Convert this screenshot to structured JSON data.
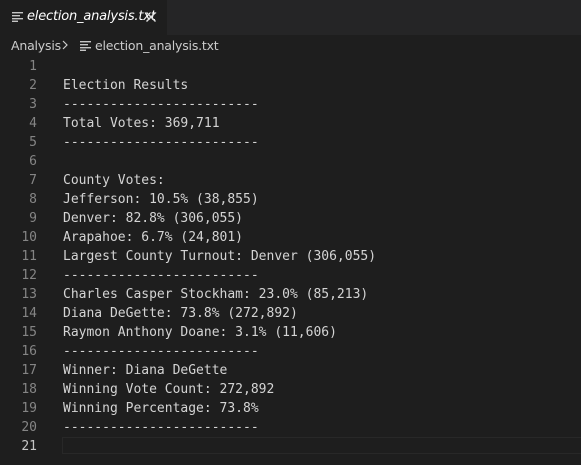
{
  "tab": {
    "label": "election_analysis.txt",
    "icon": "text-file-icon"
  },
  "breadcrumb": {
    "root": "Analysis",
    "file": "election_analysis.txt"
  },
  "colors": {
    "editor_bg": "#1e1e1e",
    "tabbar_bg": "#252526",
    "text": "#d4d4d4",
    "line_number": "#858585",
    "active_line_number": "#c6c6c6"
  },
  "editor": {
    "active_line": 21,
    "lines": [
      {
        "num": "1",
        "text": ""
      },
      {
        "num": "2",
        "text": "Election Results"
      },
      {
        "num": "3",
        "text": "-------------------------"
      },
      {
        "num": "4",
        "text": "Total Votes: 369,711"
      },
      {
        "num": "5",
        "text": "-------------------------"
      },
      {
        "num": "6",
        "text": ""
      },
      {
        "num": "7",
        "text": "County Votes:"
      },
      {
        "num": "8",
        "text": "Jefferson: 10.5% (38,855)"
      },
      {
        "num": "9",
        "text": "Denver: 82.8% (306,055)"
      },
      {
        "num": "10",
        "text": "Arapahoe: 6.7% (24,801)"
      },
      {
        "num": "11",
        "text": "Largest County Turnout: Denver (306,055)"
      },
      {
        "num": "12",
        "text": "-------------------------"
      },
      {
        "num": "13",
        "text": "Charles Casper Stockham: 23.0% (85,213)"
      },
      {
        "num": "14",
        "text": "Diana DeGette: 73.8% (272,892)"
      },
      {
        "num": "15",
        "text": "Raymon Anthony Doane: 3.1% (11,606)"
      },
      {
        "num": "16",
        "text": "-------------------------"
      },
      {
        "num": "17",
        "text": "Winner: Diana DeGette"
      },
      {
        "num": "18",
        "text": "Winning Vote Count: 272,892"
      },
      {
        "num": "19",
        "text": "Winning Percentage: 73.8%"
      },
      {
        "num": "20",
        "text": "-------------------------"
      },
      {
        "num": "21",
        "text": ""
      }
    ]
  }
}
